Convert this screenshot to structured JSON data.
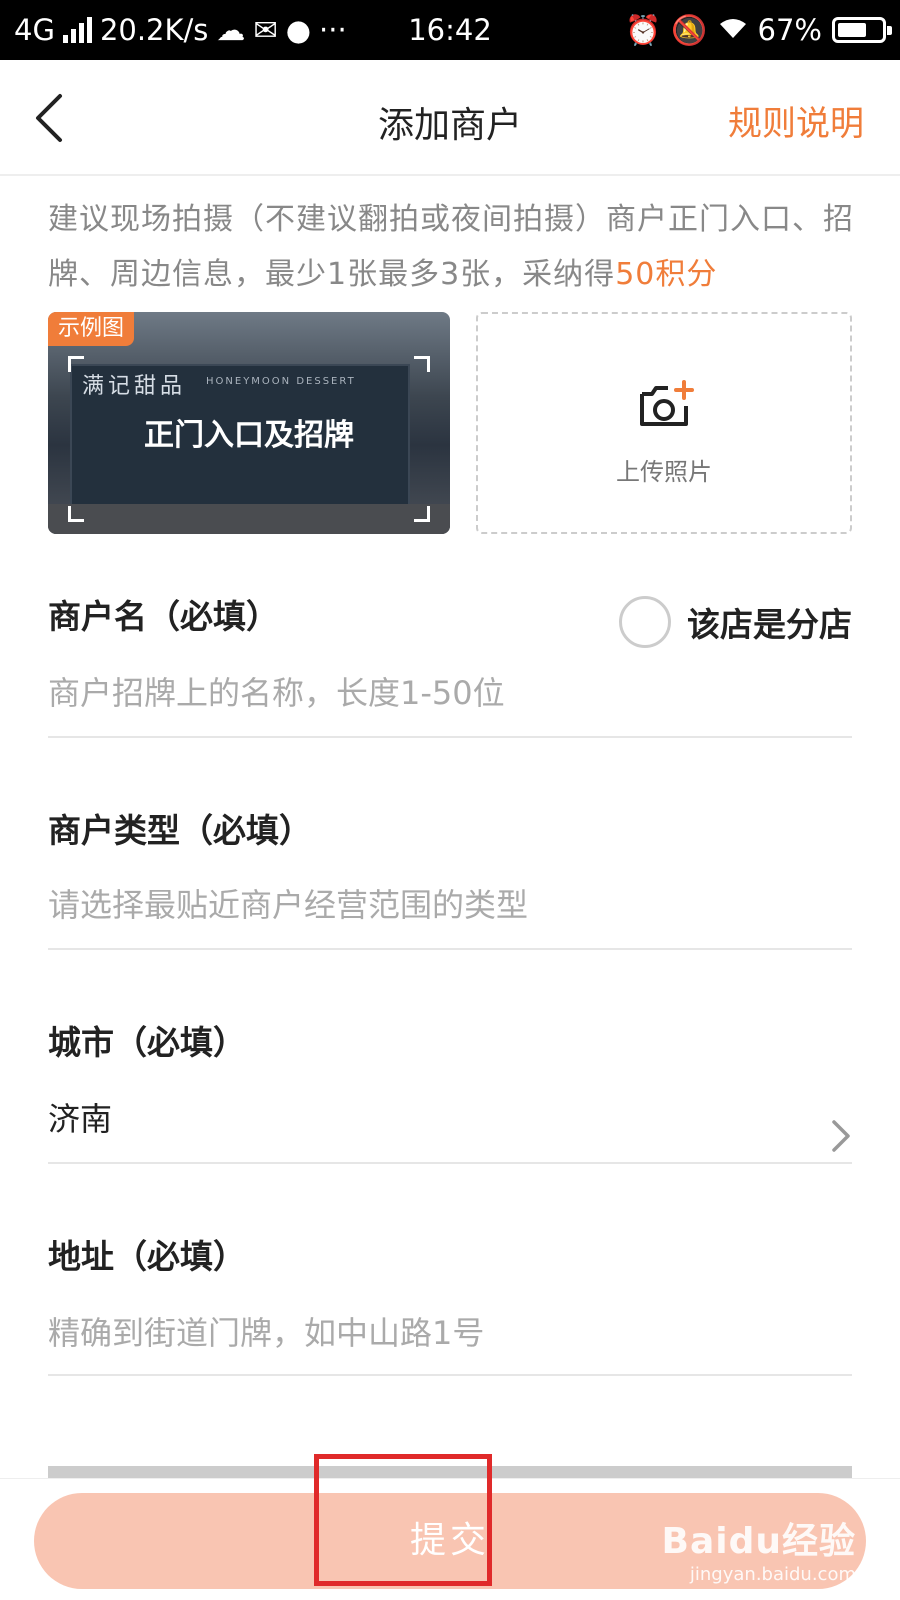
{
  "status_bar": {
    "network": "4G",
    "speed": "20.2K/s",
    "extra_icons": "···",
    "time": "16:42",
    "battery": "67%",
    "battery_level": 0.67
  },
  "navbar": {
    "title": "添加商户",
    "rules_link": "规则说明"
  },
  "tip": {
    "text": "建议现场拍摄（不建议翻拍或夜间拍摄）商户正门入口、招牌、周边信息，最少1张最多3张，采纳得",
    "reward": "50积分"
  },
  "photos": {
    "example_tag": "示例图",
    "example_caption": "正门入口及招牌",
    "example_sign": "满记甜品",
    "example_sign_sub": "HONEYMOON DESSERT",
    "upload_label": "上传照片"
  },
  "form": {
    "name": {
      "label": "商户名（必填）",
      "placeholder": "商户招牌上的名称，长度1-50位",
      "branch_label": "该店是分店",
      "branch_checked": false
    },
    "type": {
      "label": "商户类型（必填）",
      "placeholder": "请选择最贴近商户经营范围的类型"
    },
    "city": {
      "label": "城市（必填）",
      "value": "济南"
    },
    "address": {
      "label": "地址（必填）",
      "placeholder": "精确到街道门牌，如中山路1号"
    }
  },
  "submit_label": "提交",
  "watermark": {
    "main": "Baidu经验",
    "url": "jingyan.baidu.com"
  },
  "colors": {
    "accent": "#f07d3a",
    "submit_bg": "#f9c5b2",
    "highlight": "#e02a2a"
  }
}
